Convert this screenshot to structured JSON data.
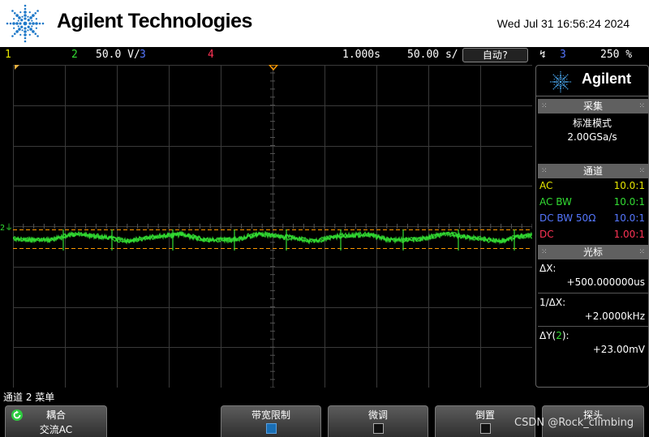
{
  "header": {
    "brand": "Agilent Technologies",
    "datetime": "Wed Jul 31 16:56:24 2024"
  },
  "statusbar": {
    "ch1": "1",
    "ch2": "2",
    "ch2_scale": "50.0 V/",
    "ch3": "3",
    "ch4": "4",
    "time_offset": "1.000s",
    "time_scale": "50.00 s/",
    "trigger_mode": "自动?",
    "trigger_icon": "rising-edge-icon",
    "trigger_source": "3",
    "trigger_level": "250 %"
  },
  "waveform": {
    "channel_marker": "2",
    "color": "#33dd33",
    "grid_color": "#3a3a3a",
    "cursor_color": "#ff9a00"
  },
  "side": {
    "logo": "Agilent",
    "acq_title": "采集",
    "acq_mode": "标准模式",
    "acq_rate": "2.00GSa/s",
    "chan_title": "通道",
    "channels": [
      {
        "coupling": "AC",
        "probe": "10.0:1",
        "color": "#e6e600"
      },
      {
        "coupling": "AC BW",
        "probe": "10.0:1",
        "color": "#33dd33"
      },
      {
        "coupling": "DC BW 50Ω",
        "probe": "10.0:1",
        "color": "#5577ff"
      },
      {
        "coupling": "DC",
        "probe": "1.00:1",
        "color": "#ff3355"
      }
    ],
    "cursor_title": "光标",
    "dx_label": "ΔX:",
    "dx_value": "+500.000000us",
    "inv_dx_label": "1/ΔX:",
    "inv_dx_value": "+2.0000kHz",
    "dy_label_prefix": "ΔY(",
    "dy_label_ch": "2",
    "dy_label_suffix": "):",
    "dy_value": "+23.00mV"
  },
  "menu": {
    "title": "通道 2 菜单",
    "coupling_top": "耦合",
    "coupling_bottom": "交流AC",
    "bw_limit": "带宽限制",
    "vernier": "微调",
    "invert": "倒置",
    "probe": "探头"
  },
  "watermark": "CSDN @Rock_climbing"
}
